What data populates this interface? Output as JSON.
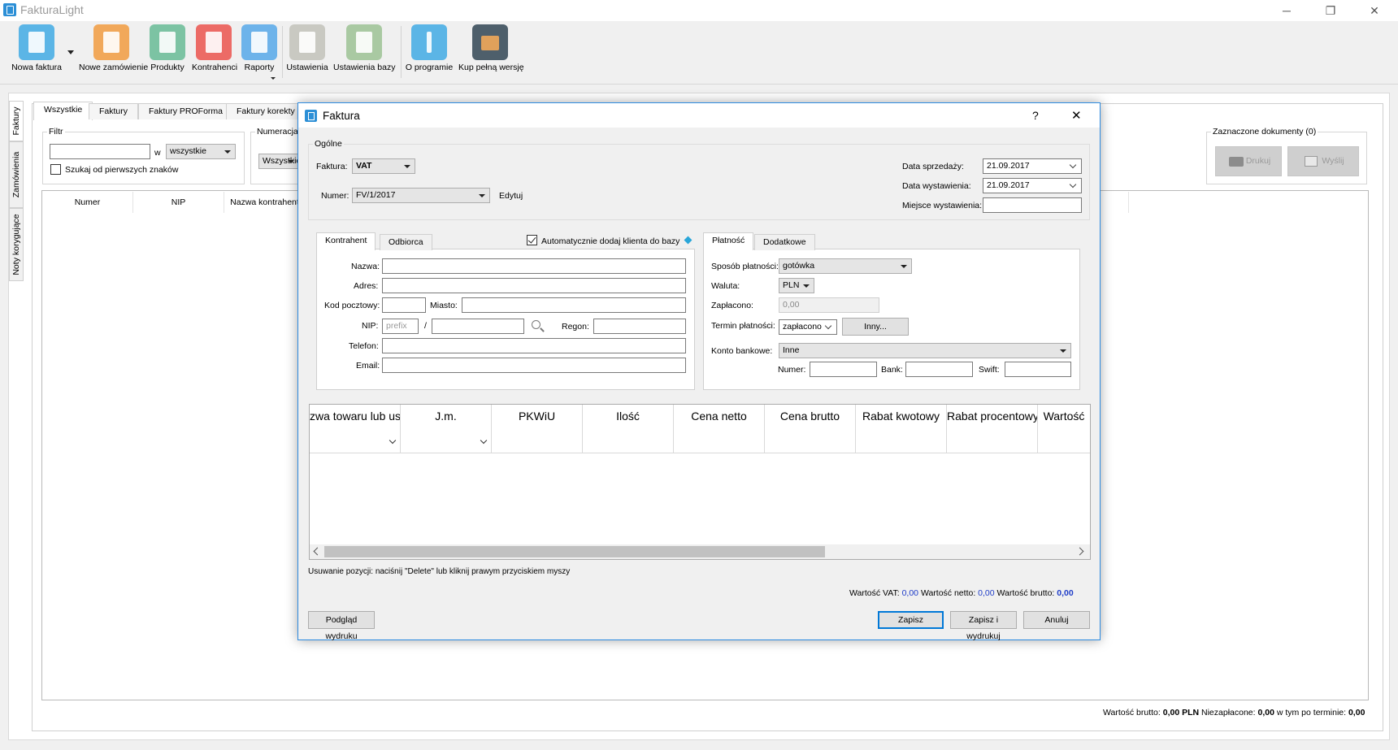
{
  "app": {
    "title": "FakturaLight"
  },
  "window_controls": {
    "minimize": "─",
    "maximize": "❐",
    "close": "✕"
  },
  "toolbar": {
    "items": [
      {
        "label": "Nowa faktura",
        "icon": "new-invoice-icon",
        "color": "#5bb5e6"
      },
      {
        "label": "Nowe zamówienie",
        "icon": "new-order-icon",
        "color": "#f1a85a"
      },
      {
        "label": "Produkty",
        "icon": "products-icon",
        "color": "#7cc3a3"
      },
      {
        "label": "Kontrahenci",
        "icon": "contacts-icon",
        "color": "#ec6b66"
      },
      {
        "label": "Raporty",
        "icon": "reports-icon",
        "color": "#6db3ea"
      },
      {
        "label": "Ustawienia",
        "icon": "settings-icon",
        "color": "#c9c9c2"
      },
      {
        "label": "Ustawienia bazy",
        "icon": "database-settings-icon",
        "color": "#a9c9a2"
      },
      {
        "label": "O programie",
        "icon": "info-icon",
        "color": "#5bb5e6"
      },
      {
        "label": "Kup pełną wersję",
        "icon": "basket-icon",
        "color": "#4e5f6b"
      }
    ]
  },
  "side_tabs": [
    "Faktury",
    "Zamówienia",
    "Noty korygujące"
  ],
  "doc_tabs": [
    "Wszystkie",
    "Faktury",
    "Faktury PROForma",
    "Faktury korekty"
  ],
  "filter": {
    "title": "Filtr",
    "w_label": "w",
    "scope_value": "wszystkie",
    "prefix_search_label": "Szukaj od pierwszych znaków"
  },
  "numbering": {
    "title": "Numeracja",
    "value": "Wszystkie"
  },
  "selected_docs": {
    "title": "Zaznaczone dokumenty (0)",
    "print": "Drukuj",
    "send": "Wyślij"
  },
  "list_columns": [
    "Numer",
    "NIP",
    "Nazwa kontrahent"
  ],
  "footer": {
    "gross_label": "Wartość brutto:",
    "gross_value": "0,00",
    "currency": "PLN",
    "unpaid_label": "Niezapłacone:",
    "unpaid_value": "0,00",
    "overdue_label": "w tym po terminie:",
    "overdue_value": "0,00"
  },
  "dialog": {
    "title": "Faktura",
    "help": "?",
    "close": "✕",
    "general": {
      "title": "Ogólne",
      "invoice_type_label": "Faktura:",
      "invoice_type": "VAT",
      "number_label": "Numer:",
      "number": "FV/1/2017",
      "edit_label": "Edytuj",
      "sale_date_label": "Data sprzedaży:",
      "sale_date": "21.09.2017",
      "issue_date_label": "Data wystawienia:",
      "issue_date": "21.09.2017",
      "place_label": "Miejsce wystawienia:",
      "place": ""
    },
    "party_tabs": [
      "Kontrahent",
      "Odbiorca"
    ],
    "auto_add_label": "Automatycznie dodaj klienta do bazy",
    "party": {
      "name_label": "Nazwa:",
      "address_label": "Adres:",
      "postal_label": "Kod pocztowy:",
      "city_label": "Miasto:",
      "nip_label": "NIP:",
      "nip_prefix_placeholder": "prefix",
      "nip_sep": "/",
      "regon_label": "Regon:",
      "phone_label": "Telefon:",
      "email_label": "Email:"
    },
    "payment_tabs": [
      "Płatność",
      "Dodatkowe"
    ],
    "payment": {
      "method_label": "Sposób płatności:",
      "method": "gotówka",
      "currency_label": "Waluta:",
      "currency": "PLN",
      "paid_label": "Zapłacono:",
      "paid": "0,00",
      "term_label": "Termin płatności:",
      "term": "zapłacono",
      "other_button": "Inny...",
      "account_label": "Konto bankowe:",
      "account": "Inne",
      "acc_number_label": "Numer:",
      "bank_label": "Bank:",
      "swift_label": "Swift:"
    },
    "grid_columns": [
      "zwa towaru lub us",
      "J.m.",
      "PKWiU",
      "Ilość",
      "Cena netto",
      "Cena brutto",
      "Rabat kwotowy",
      "Rabat procentowy",
      "Wartość"
    ],
    "hint": "Usuwanie pozycji: naciśnij \"Delete\" lub kliknij prawym przyciskiem myszy",
    "totals": {
      "vat_label": "Wartość VAT:",
      "vat": "0,00",
      "net_label": "Wartość netto:",
      "net": "0,00",
      "gross_label": "Wartość brutto:",
      "gross": "0,00"
    },
    "buttons": {
      "preview": "Podgląd wydruku",
      "save": "Zapisz",
      "save_print": "Zapisz i wydrukuj",
      "cancel": "Anuluj"
    }
  }
}
